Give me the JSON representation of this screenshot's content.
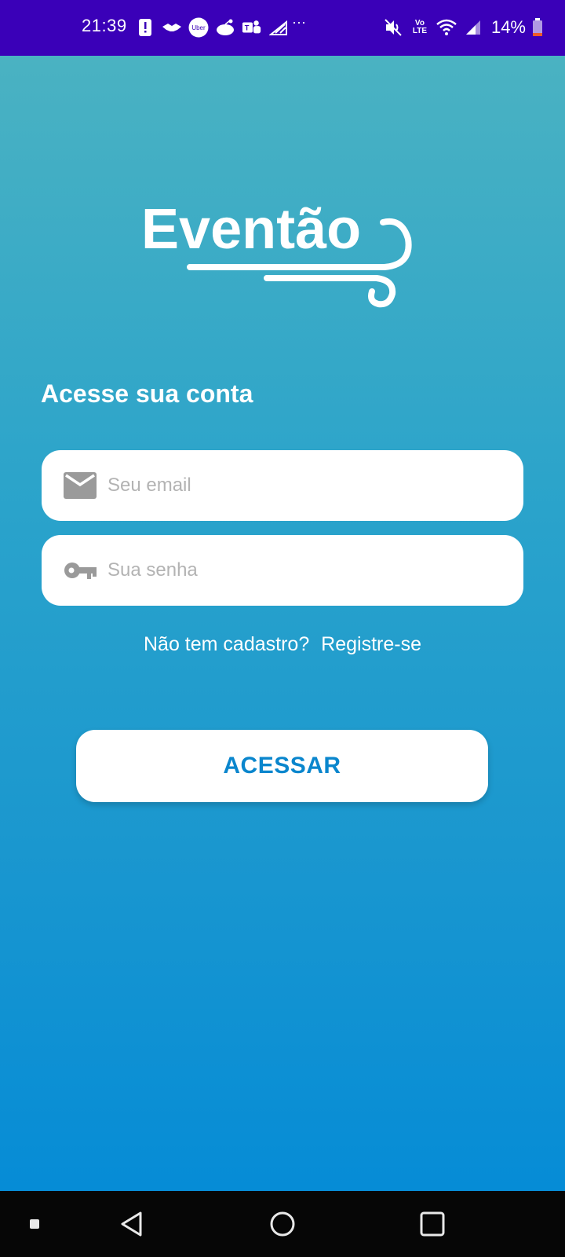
{
  "status_bar": {
    "time": "21:39",
    "battery_percent": "14%",
    "overflow_indicator": "···",
    "left_icons": [
      "alert-icon",
      "handshake-icon",
      "uber-icon",
      "reddit-icon",
      "teams-icon",
      "signal-icon"
    ],
    "right_icons": [
      "vibrate-mute-icon",
      "volte-icon",
      "wifi-icon",
      "cellular-signal-icon",
      "battery-icon"
    ],
    "uber_text": "Uber",
    "volte_text_top": "Vo",
    "volte_text_bottom": "LTE",
    "background": "#3a00b8",
    "battery_level_color": "#f05a28"
  },
  "app": {
    "logo_text": "Eventão",
    "heading": "Acesse sua conta",
    "email_field": {
      "placeholder": "Seu email",
      "value": "",
      "icon": "email-icon"
    },
    "password_field": {
      "placeholder": "Sua senha",
      "value": "",
      "icon": "key-icon"
    },
    "register_prompt": "Não tem cadastro?",
    "register_link": "Registre-se",
    "submit_label": "ACESSAR",
    "colors": {
      "gradient_top": "#4ab2c2",
      "gradient_bottom": "#068cd6",
      "button_text": "#0a86cd",
      "placeholder": "#b3b3b3",
      "input_icon": "#9a9a9a"
    }
  },
  "nav_bar": {
    "buttons": [
      "recent-apps-dot-icon",
      "back-icon",
      "home-icon",
      "overview-icon"
    ]
  }
}
